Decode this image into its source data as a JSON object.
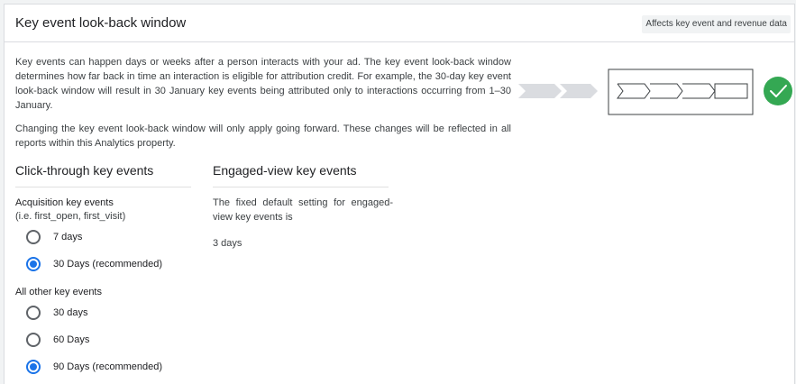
{
  "header": {
    "title": "Key event look-back window",
    "badge": "Affects key event and revenue data"
  },
  "description": {
    "paragraph1": "Key events can happen days or weeks after a person interacts with your ad. The key event look-back window determines how far back in time an interaction is eligible for attribution credit. For example, the 30-day key event look-back window will result in 30 January key events being attributed only to interactions occurring from 1–30 January.",
    "paragraph2": "Changing the key event look-back window will only apply going forward. These changes will be reflected in all reports within this Analytics property."
  },
  "illustration": {
    "arrow_color": "#dadce0",
    "check_color": "#34a853",
    "icon": "check-circle-icon"
  },
  "click_through": {
    "title": "Click-through key events",
    "acquisition": {
      "label": "Acquisition key events",
      "sublabel": "(i.e. first_open, first_visit)",
      "options": [
        {
          "label": "7 days",
          "checked": false
        },
        {
          "label": "30 Days (recommended)",
          "checked": true
        }
      ]
    },
    "other": {
      "label": "All other key events",
      "options": [
        {
          "label": "30 days",
          "checked": false
        },
        {
          "label": "60 Days",
          "checked": false
        },
        {
          "label": "90 Days (recommended)",
          "checked": true
        }
      ]
    }
  },
  "engaged_view": {
    "title": "Engaged-view key events",
    "text": "The fixed default setting for engaged-view key events is",
    "value": "3 days"
  }
}
